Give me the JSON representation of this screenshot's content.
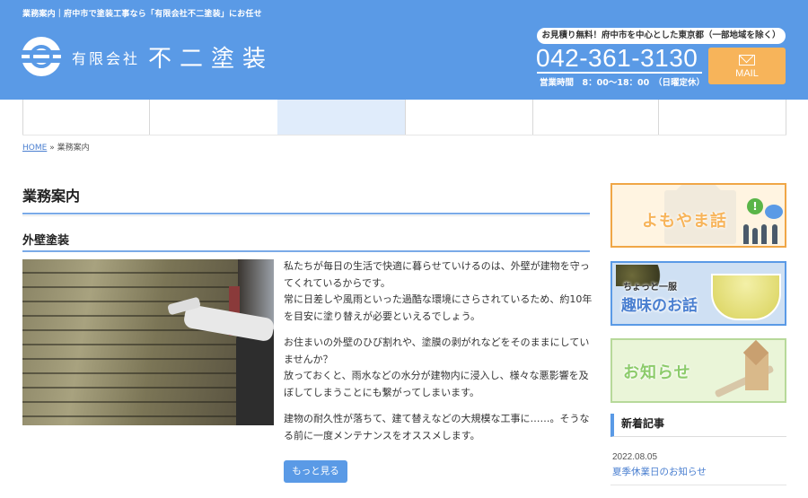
{
  "header": {
    "tagline": "業務案内｜府中市で塗装工事なら「有限会社不二塗装」にお任せ",
    "company_prefix": "有限会社",
    "company_name": "不二塗装",
    "estimate_notice": "お見積り無料！府中市を中心とした東京都（一部地域を除く）",
    "phone": "042-361-3130",
    "hours": "営業時間　8：00〜18：00　（日曜定休）",
    "mail_label": "MAIL"
  },
  "breadcrumb": {
    "home": "HOME",
    "separator": "»",
    "current": "業務案内"
  },
  "main": {
    "page_title": "業務案内",
    "section_title": "外壁塗装",
    "paragraphs": [
      "私たちが毎日の生活で快適に暮らせていけるのは、外壁が建物を守ってくれているからです。\n常に日差しや風雨といった過酷な環境にさらされているため、約10年を目安に塗り替えが必要といえるでしょう。",
      "お住まいの外壁のひび割れや、塗膜の剥がれなどをそのままにしていませんか？\n放っておくと、雨水などの水分が建物内に浸入し、様々な悪影響を及ぼしてしまうことにも繋がってしまいます。",
      "建物の耐久性が落ちて、建て替えなどの大規模な工事に……。そうなる前に一度メンテナンスをオススメします。"
    ],
    "more_button": "もっと見る"
  },
  "sidebar": {
    "banners": [
      {
        "label": "よもやま話"
      },
      {
        "small": "ちょっと一服",
        "label": "趣味のお話"
      },
      {
        "label": "お知らせ"
      }
    ],
    "news": {
      "heading": "新着記事",
      "items": [
        {
          "date": "2022.08.05",
          "title": "夏季休業日のお知らせ"
        }
      ]
    }
  },
  "colors": {
    "brand_blue": "#5a9ae6",
    "accent_orange": "#f7b45a",
    "nav_active": "#e0ecfb"
  }
}
